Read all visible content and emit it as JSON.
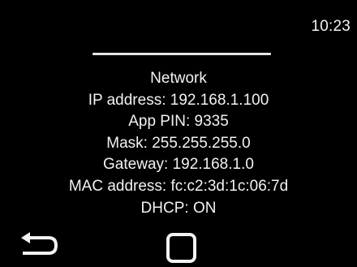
{
  "status_bar": {
    "time": "10:23"
  },
  "network_panel": {
    "title": "Network",
    "lines": [
      "IP address: 192.168.1.100",
      "App PIN: 9335",
      "Mask: 255.255.255.0",
      "Gateway: 192.168.1.0",
      "MAC address: fc:c2:3d:1c:06:7d",
      "DHCP: ON"
    ]
  },
  "nav": {
    "back_icon": "back-arrow-icon",
    "home_icon": "home-square-icon"
  },
  "colors": {
    "background": "#000000",
    "foreground": "#f2f2f2"
  }
}
